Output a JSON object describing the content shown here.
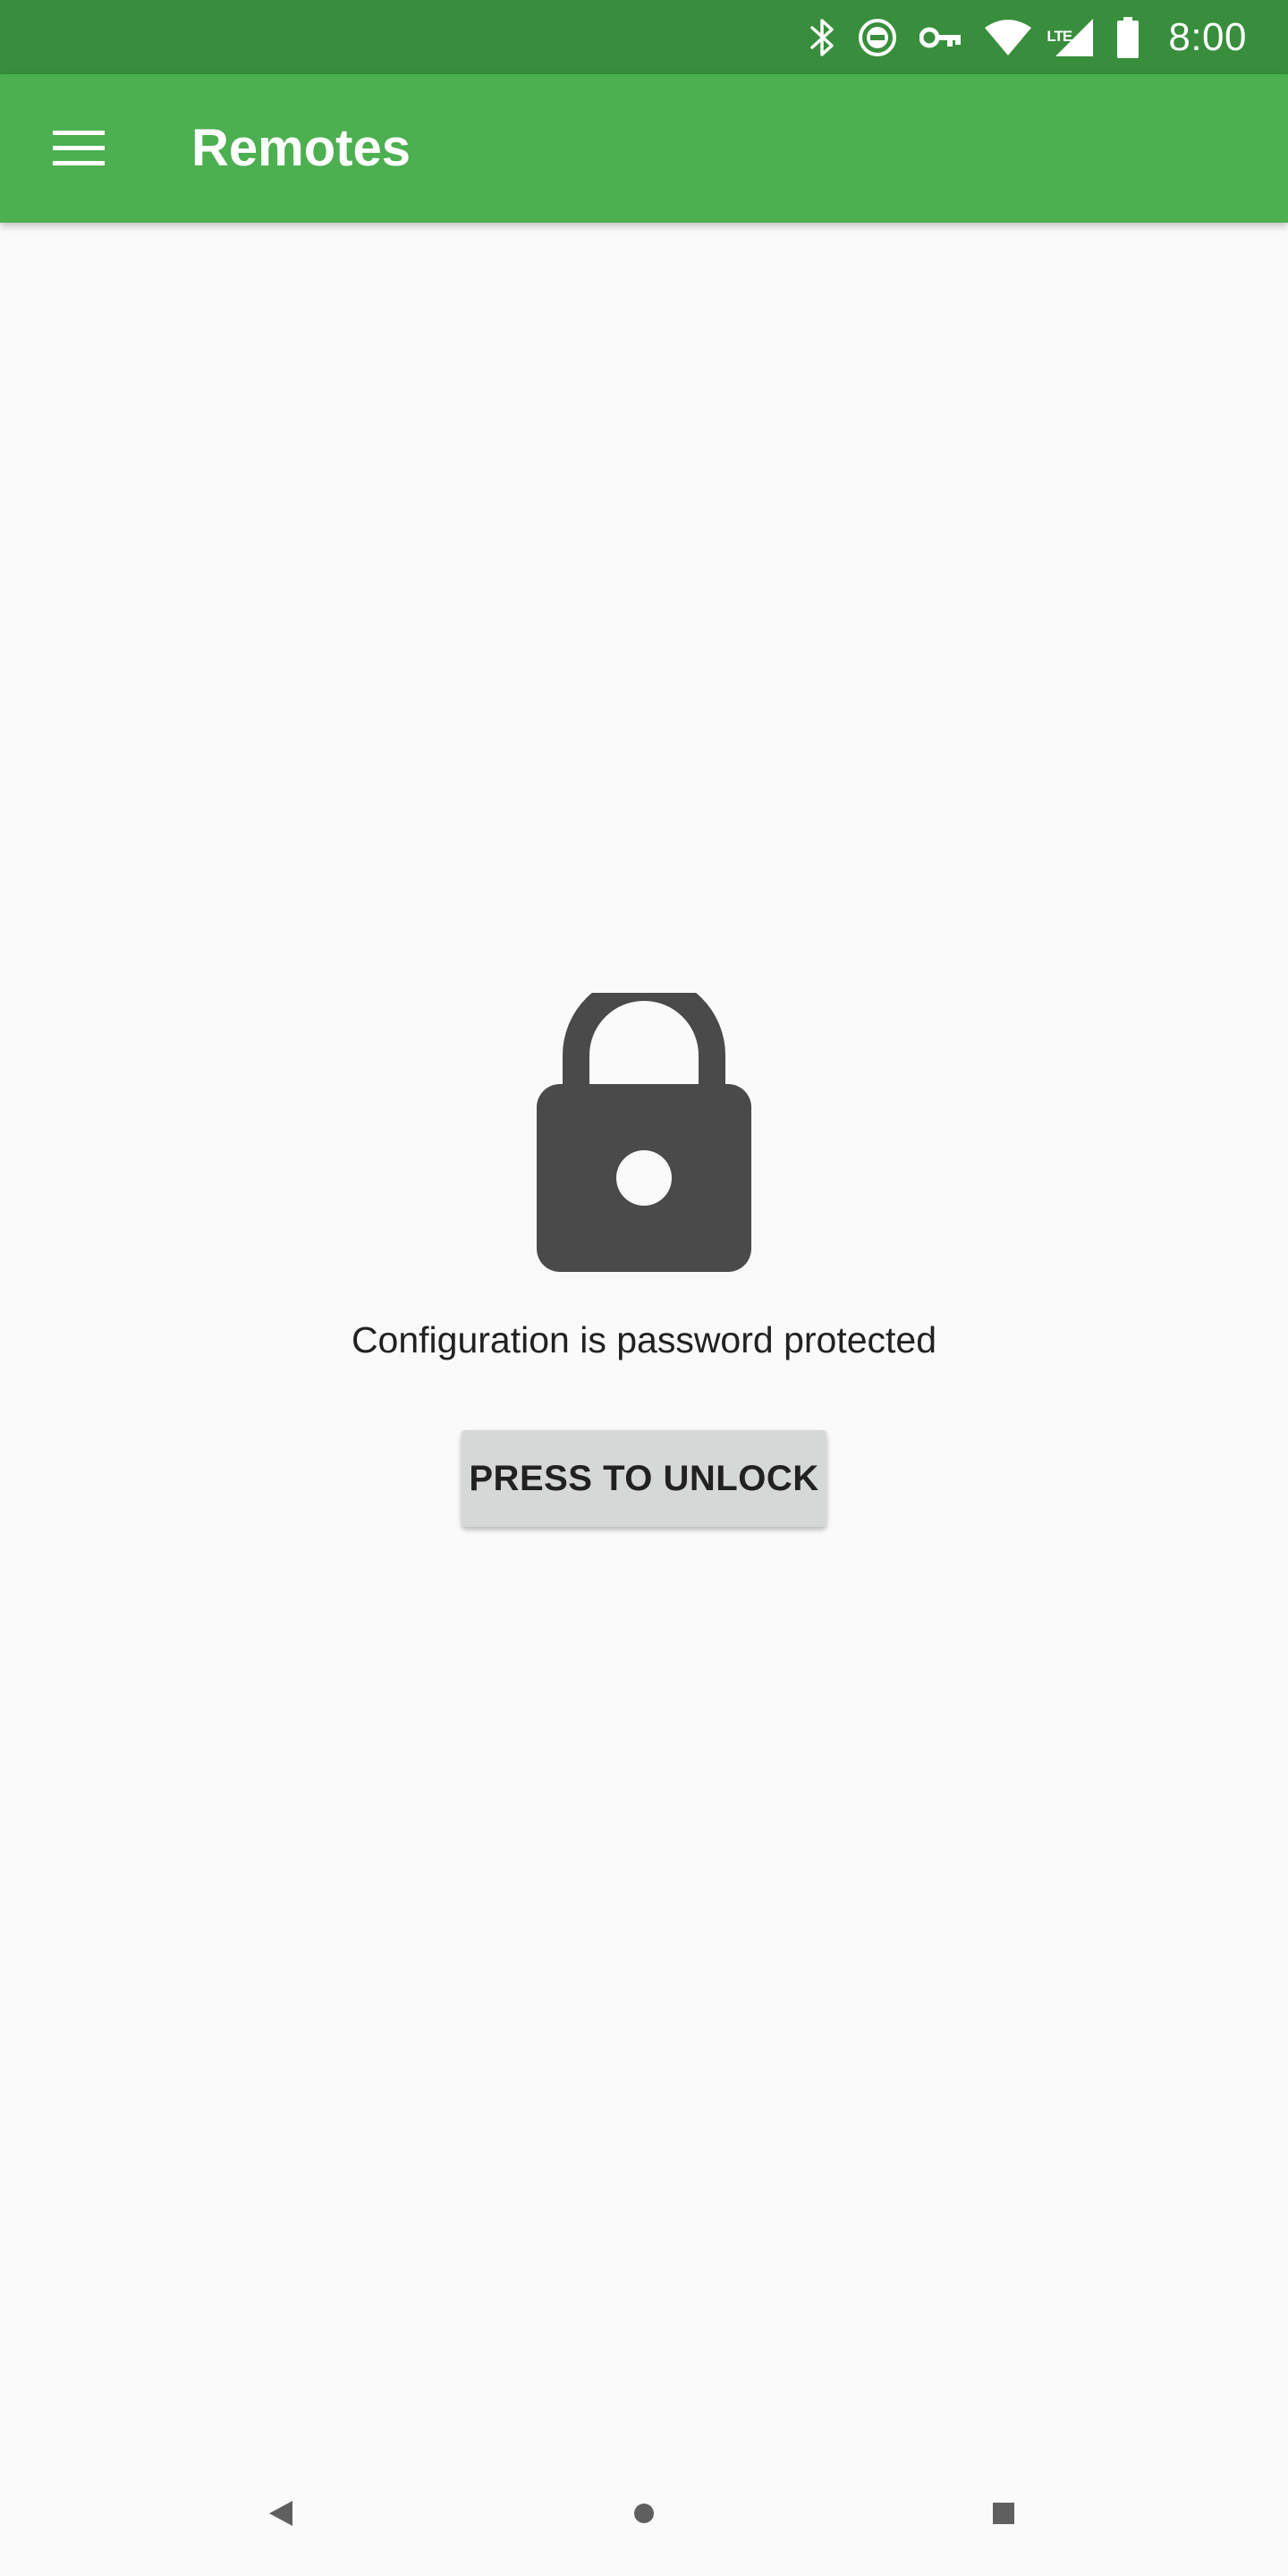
{
  "status_bar": {
    "time": "8:00",
    "icons": [
      "bluetooth-icon",
      "do-not-disturb-icon",
      "vpn-key-icon",
      "wifi-icon",
      "lte-signal-icon",
      "battery-icon"
    ],
    "lte_label": "LTE",
    "color": "#388e3c"
  },
  "app_bar": {
    "title": "Remotes",
    "menu_icon": "hamburger-menu-icon",
    "color": "#4caf50"
  },
  "main": {
    "lock_icon": "lock-icon",
    "message": "Configuration is password protected",
    "unlock_button_label": "PRESS TO UNLOCK"
  },
  "nav_bar": {
    "icons": [
      "back-icon",
      "home-icon",
      "recents-icon"
    ]
  },
  "colors": {
    "background": "#fafafa",
    "icon_dark": "#4a4a4a",
    "button_bg": "#d6d7d7"
  }
}
